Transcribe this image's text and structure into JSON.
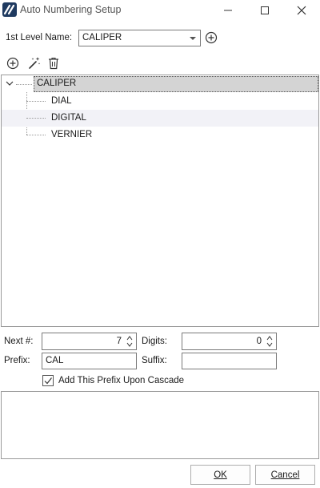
{
  "window": {
    "title": "Auto Numbering Setup",
    "icons": [
      "app-logo-icon",
      "minimize-icon",
      "maximize-icon",
      "close-icon"
    ]
  },
  "level": {
    "label": "1st Level Name:",
    "selected": "CALIPER"
  },
  "toolbar": {
    "icons": [
      "add-circle-icon",
      "magic-wand-icon",
      "trash-icon"
    ]
  },
  "tree": {
    "root": "CALIPER",
    "children": [
      "DIAL",
      "DIGITAL",
      "VERNIER"
    ]
  },
  "form": {
    "next_label": "Next #:",
    "next_value": "7",
    "digits_label": "Digits:",
    "digits_value": "0",
    "prefix_label": "Prefix:",
    "prefix_value": "CAL",
    "suffix_label": "Suffix:",
    "suffix_value": "",
    "cascade_label": "Add This Prefix Upon Cascade",
    "cascade_checked": true
  },
  "buttons": {
    "ok": "OK",
    "cancel": "Cancel"
  },
  "colors": {
    "accent": "#1f3a60",
    "selection": "#d4d4d4",
    "alt_row": "#f2f2f7"
  }
}
